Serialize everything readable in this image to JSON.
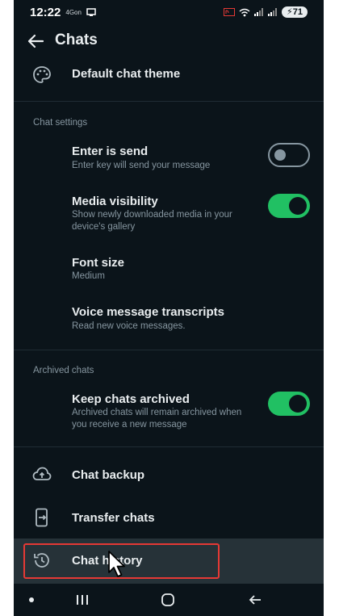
{
  "status": {
    "time": "12:22",
    "small_text": "4Gon",
    "battery": "71"
  },
  "appbar": {
    "title": "Chats"
  },
  "rows": {
    "theme": {
      "title": "Default chat theme"
    },
    "enter": {
      "title": "Enter is send",
      "subtitle": "Enter key will send your message",
      "toggle": false
    },
    "media": {
      "title": "Media visibility",
      "subtitle": "Show newly downloaded media in your device's gallery",
      "toggle": true
    },
    "font": {
      "title": "Font size",
      "subtitle": "Medium"
    },
    "voice": {
      "title": "Voice message transcripts",
      "subtitle": "Read new voice messages."
    },
    "keep": {
      "title": "Keep chats archived",
      "subtitle": "Archived chats will remain archived when you receive a new message",
      "toggle": true
    },
    "backup": {
      "title": "Chat backup"
    },
    "transfer": {
      "title": "Transfer chats"
    },
    "history": {
      "title": "Chat history"
    }
  },
  "sections": {
    "chat_settings": "Chat settings",
    "archived_chats": "Archived chats"
  },
  "colors": {
    "background": "#0b141a",
    "accent": "#21c063",
    "highlight": "#263238",
    "annotation": "#e53935"
  },
  "icons": [
    "back-arrow-icon",
    "palette-icon",
    "cloud-upload-icon",
    "transfer-phone-icon",
    "history-icon",
    "home-icon",
    "recents-icon",
    "back-nav-icon"
  ]
}
